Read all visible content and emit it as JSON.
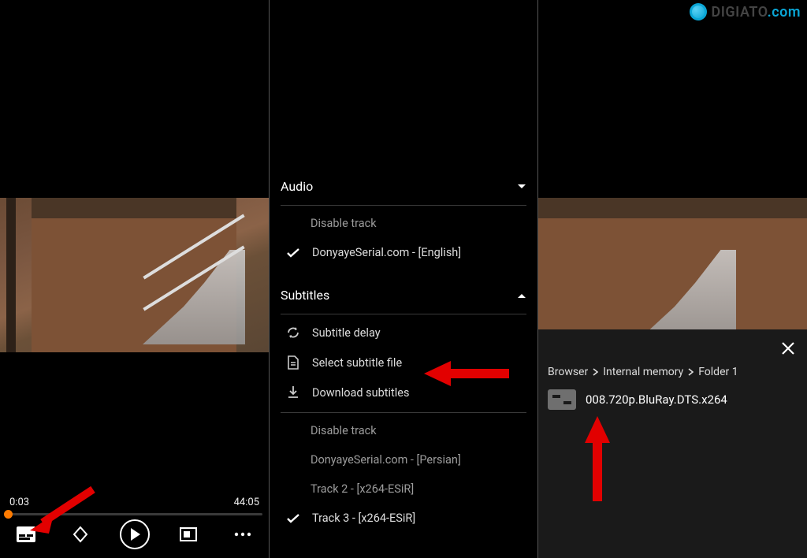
{
  "watermark": {
    "brand": "DIGIATO",
    "tld": ".com"
  },
  "player": {
    "current_time": "0:03",
    "total_time": "44:05"
  },
  "menu": {
    "audio": {
      "title": "Audio",
      "disable_label": "Disable track",
      "selected_track": "DonyayeSerial.com - [English]"
    },
    "subtitles": {
      "title": "Subtitles",
      "delay_label": "Subtitle delay",
      "select_file_label": "Select subtitle file",
      "download_label": "Download subtitles",
      "disable_label": "Disable track",
      "tracks": [
        "DonyayeSerial.com - [Persian]",
        "Track 2 - [x264-ESiR]",
        "Track 3 - [x264-ESiR]"
      ]
    }
  },
  "browser": {
    "crumb1": "Browser",
    "crumb2": "Internal memory",
    "crumb3": "Folder 1",
    "file_name": "008.720p.BluRay.DTS.x264"
  }
}
